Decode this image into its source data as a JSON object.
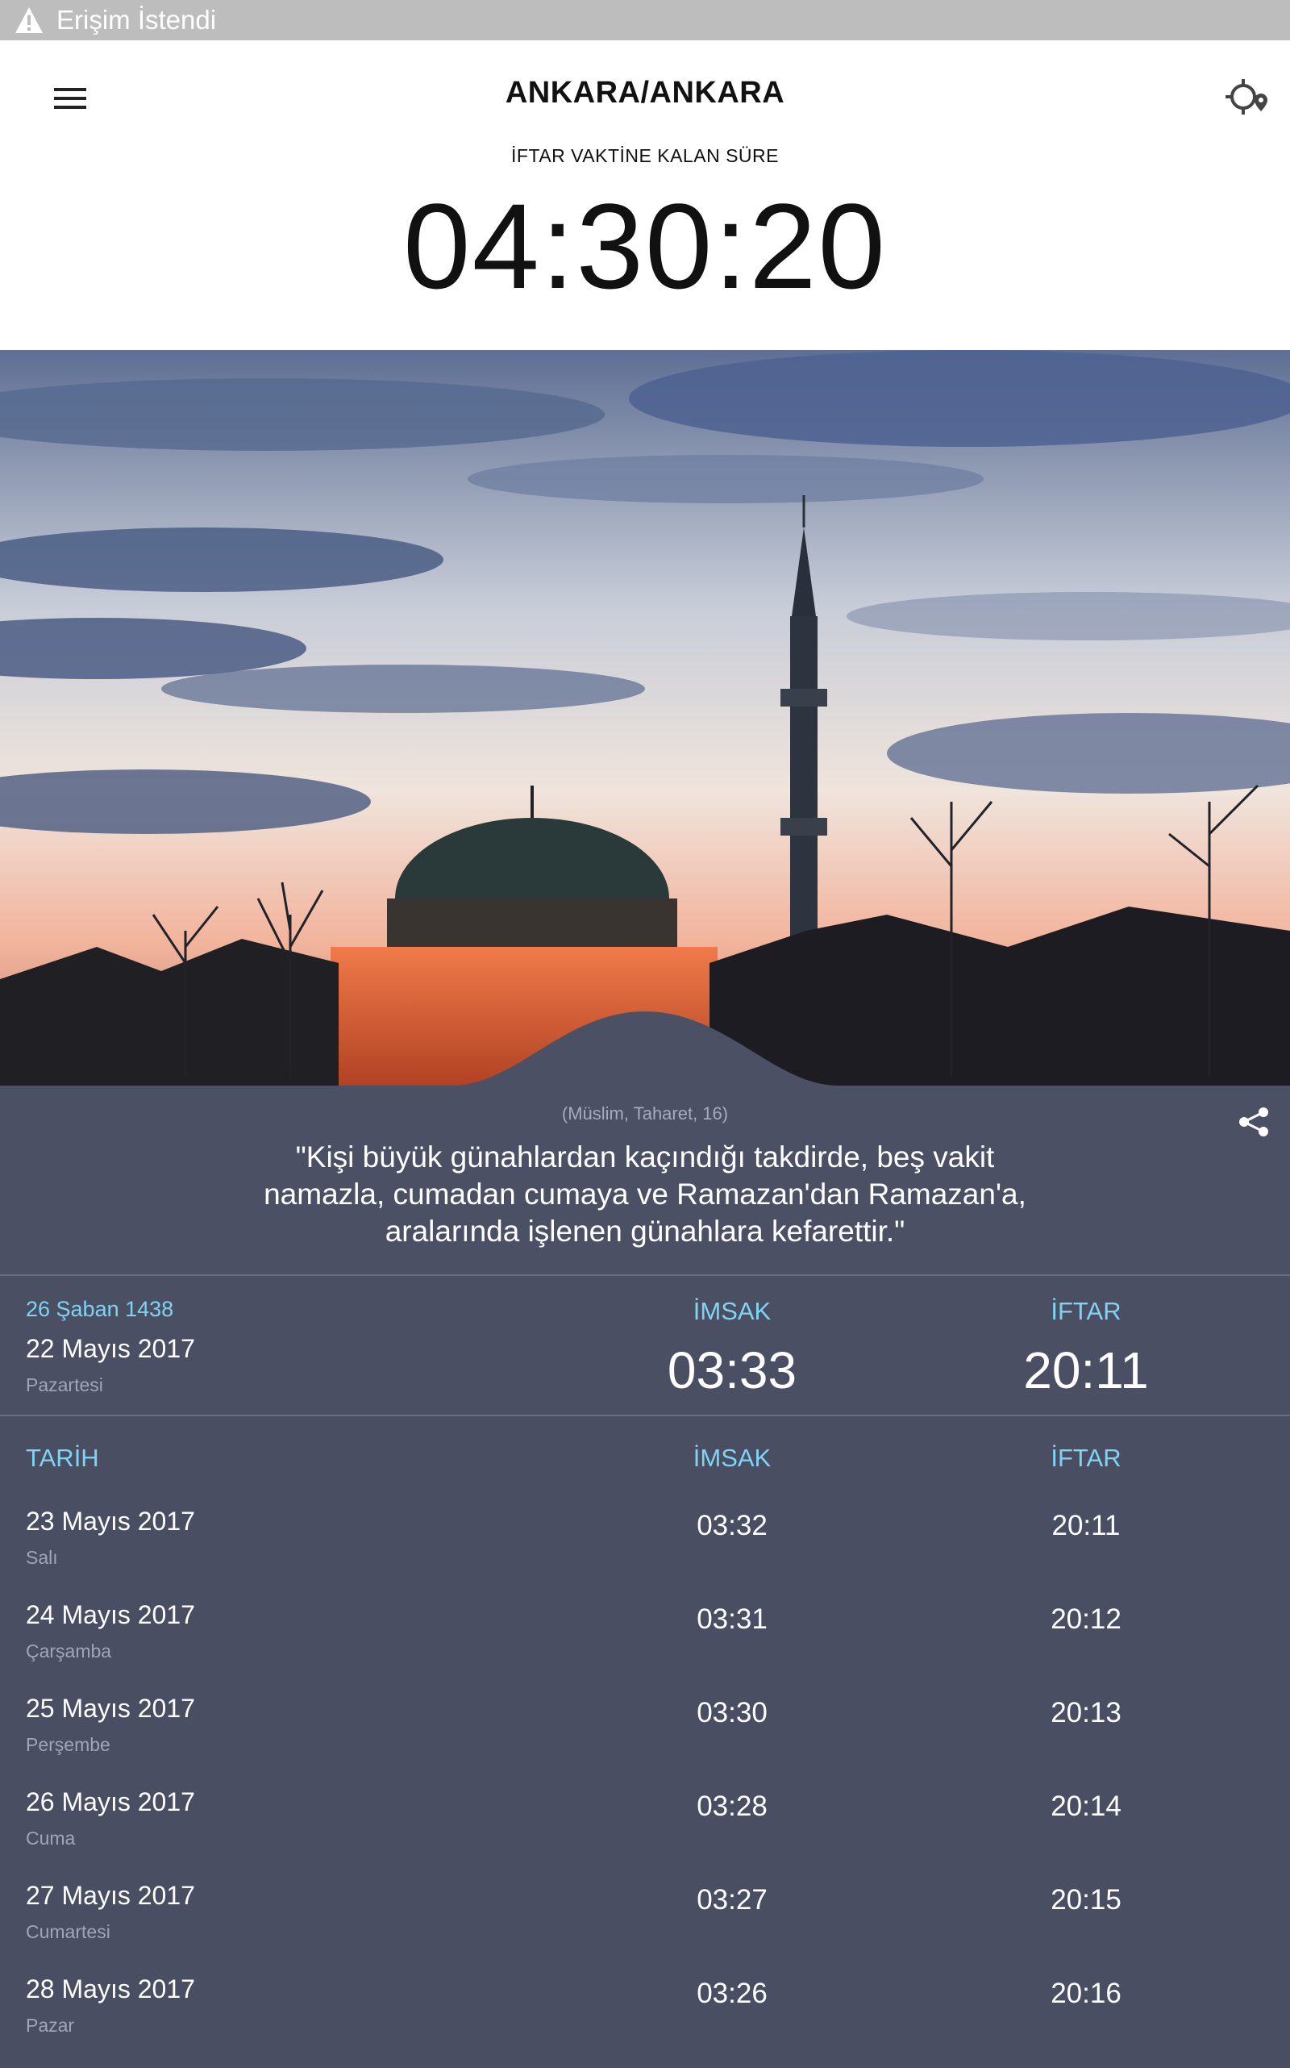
{
  "status_bar": {
    "text": "Erişim İstendi",
    "icon": "warning-icon"
  },
  "header": {
    "city": "ANKARA/ANKARA",
    "countdown_label": "İFTAR VAKTİNE KALAN SÜRE",
    "countdown": "04:30:20",
    "menu_icon": "hamburger-menu-icon",
    "location_icon": "location-target-icon"
  },
  "hero": {
    "description": "Mosque silhouette at sunset"
  },
  "quote": {
    "source": "(Müslim, Taharet, 16)",
    "lines": [
      "\"Kişi büyük günahlardan kaçındığı takdirde, beş vakit",
      "namazla, cumadan cumaya ve Ramazan'dan Ramazan'a,",
      "aralarında işlenen günahlara kefarettir.\""
    ],
    "share_icon": "share-icon"
  },
  "today": {
    "hijri": "26 Şaban 1438",
    "date": "22 Mayıs 2017",
    "day": "Pazartesi",
    "imsak_label": "İMSAK",
    "imsak": "03:33",
    "iftar_label": "İFTAR",
    "iftar": "20:11"
  },
  "table": {
    "headers": {
      "date": "TARİH",
      "imsak": "İMSAK",
      "iftar": "İFTAR"
    },
    "rows": [
      {
        "date": "23 Mayıs 2017",
        "day": "Salı",
        "imsak": "03:32",
        "iftar": "20:11"
      },
      {
        "date": "24 Mayıs 2017",
        "day": "Çarşamba",
        "imsak": "03:31",
        "iftar": "20:12"
      },
      {
        "date": "25 Mayıs 2017",
        "day": "Perşembe",
        "imsak": "03:30",
        "iftar": "20:13"
      },
      {
        "date": "26 Mayıs 2017",
        "day": "Cuma",
        "imsak": "03:28",
        "iftar": "20:14"
      },
      {
        "date": "27 Mayıs 2017",
        "day": "Cumartesi",
        "imsak": "03:27",
        "iftar": "20:15"
      },
      {
        "date": "28 Mayıs 2017",
        "day": "Pazar",
        "imsak": "03:26",
        "iftar": "20:16"
      }
    ]
  },
  "colors": {
    "accent": "#7fd3f3",
    "panel": "#4b4f63",
    "header_bg": "#ffffff",
    "status_bar": "#bdbdbd"
  }
}
